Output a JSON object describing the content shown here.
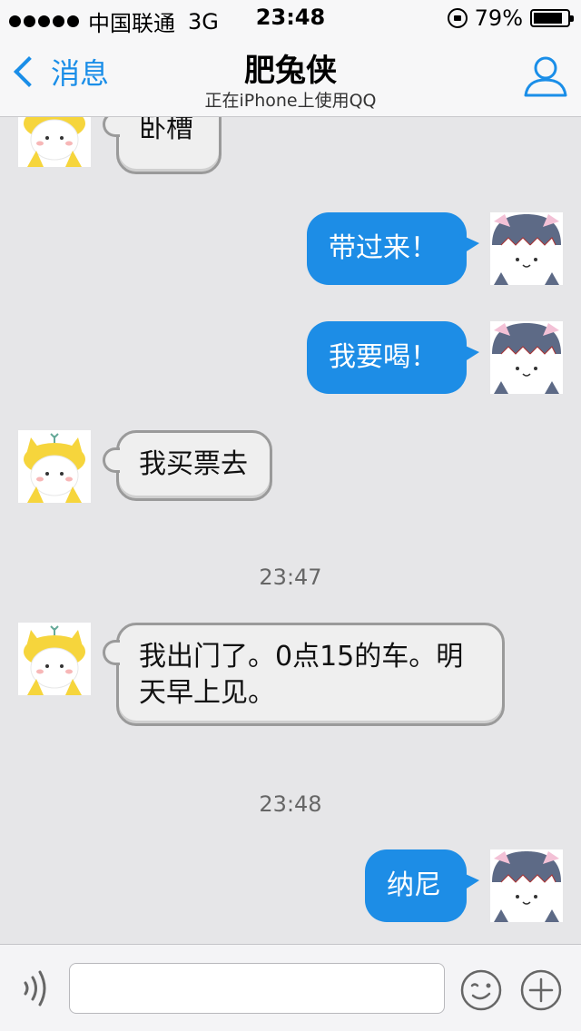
{
  "status": {
    "carrier": "中国联通",
    "network": "3G",
    "time": "23:48",
    "battery": "79%"
  },
  "nav": {
    "back_label": "消息",
    "title": "肥兔侠",
    "subtitle": "正在iPhone上使用QQ"
  },
  "messages": [
    {
      "side": "in",
      "text": "卧槽"
    },
    {
      "side": "out",
      "text": "带过来！"
    },
    {
      "side": "out",
      "text": "我要喝！"
    },
    {
      "side": "in",
      "text": "我买票去"
    },
    {
      "time": "23:47"
    },
    {
      "side": "in",
      "text": "我出门了。0点15的车。明天早上见。"
    },
    {
      "time": "23:48"
    },
    {
      "side": "out",
      "text": "纳尼"
    }
  ],
  "input": {
    "placeholder": ""
  },
  "colors": {
    "accent": "#1a8ee8",
    "outgoing_bubble": "#1d8de6",
    "chat_background": "#e6e6e8"
  },
  "icons": {
    "back": "chevron-left-icon",
    "profile": "person-icon",
    "voice": "voice-icon",
    "emoji": "emoji-icon",
    "plus": "plus-icon"
  }
}
